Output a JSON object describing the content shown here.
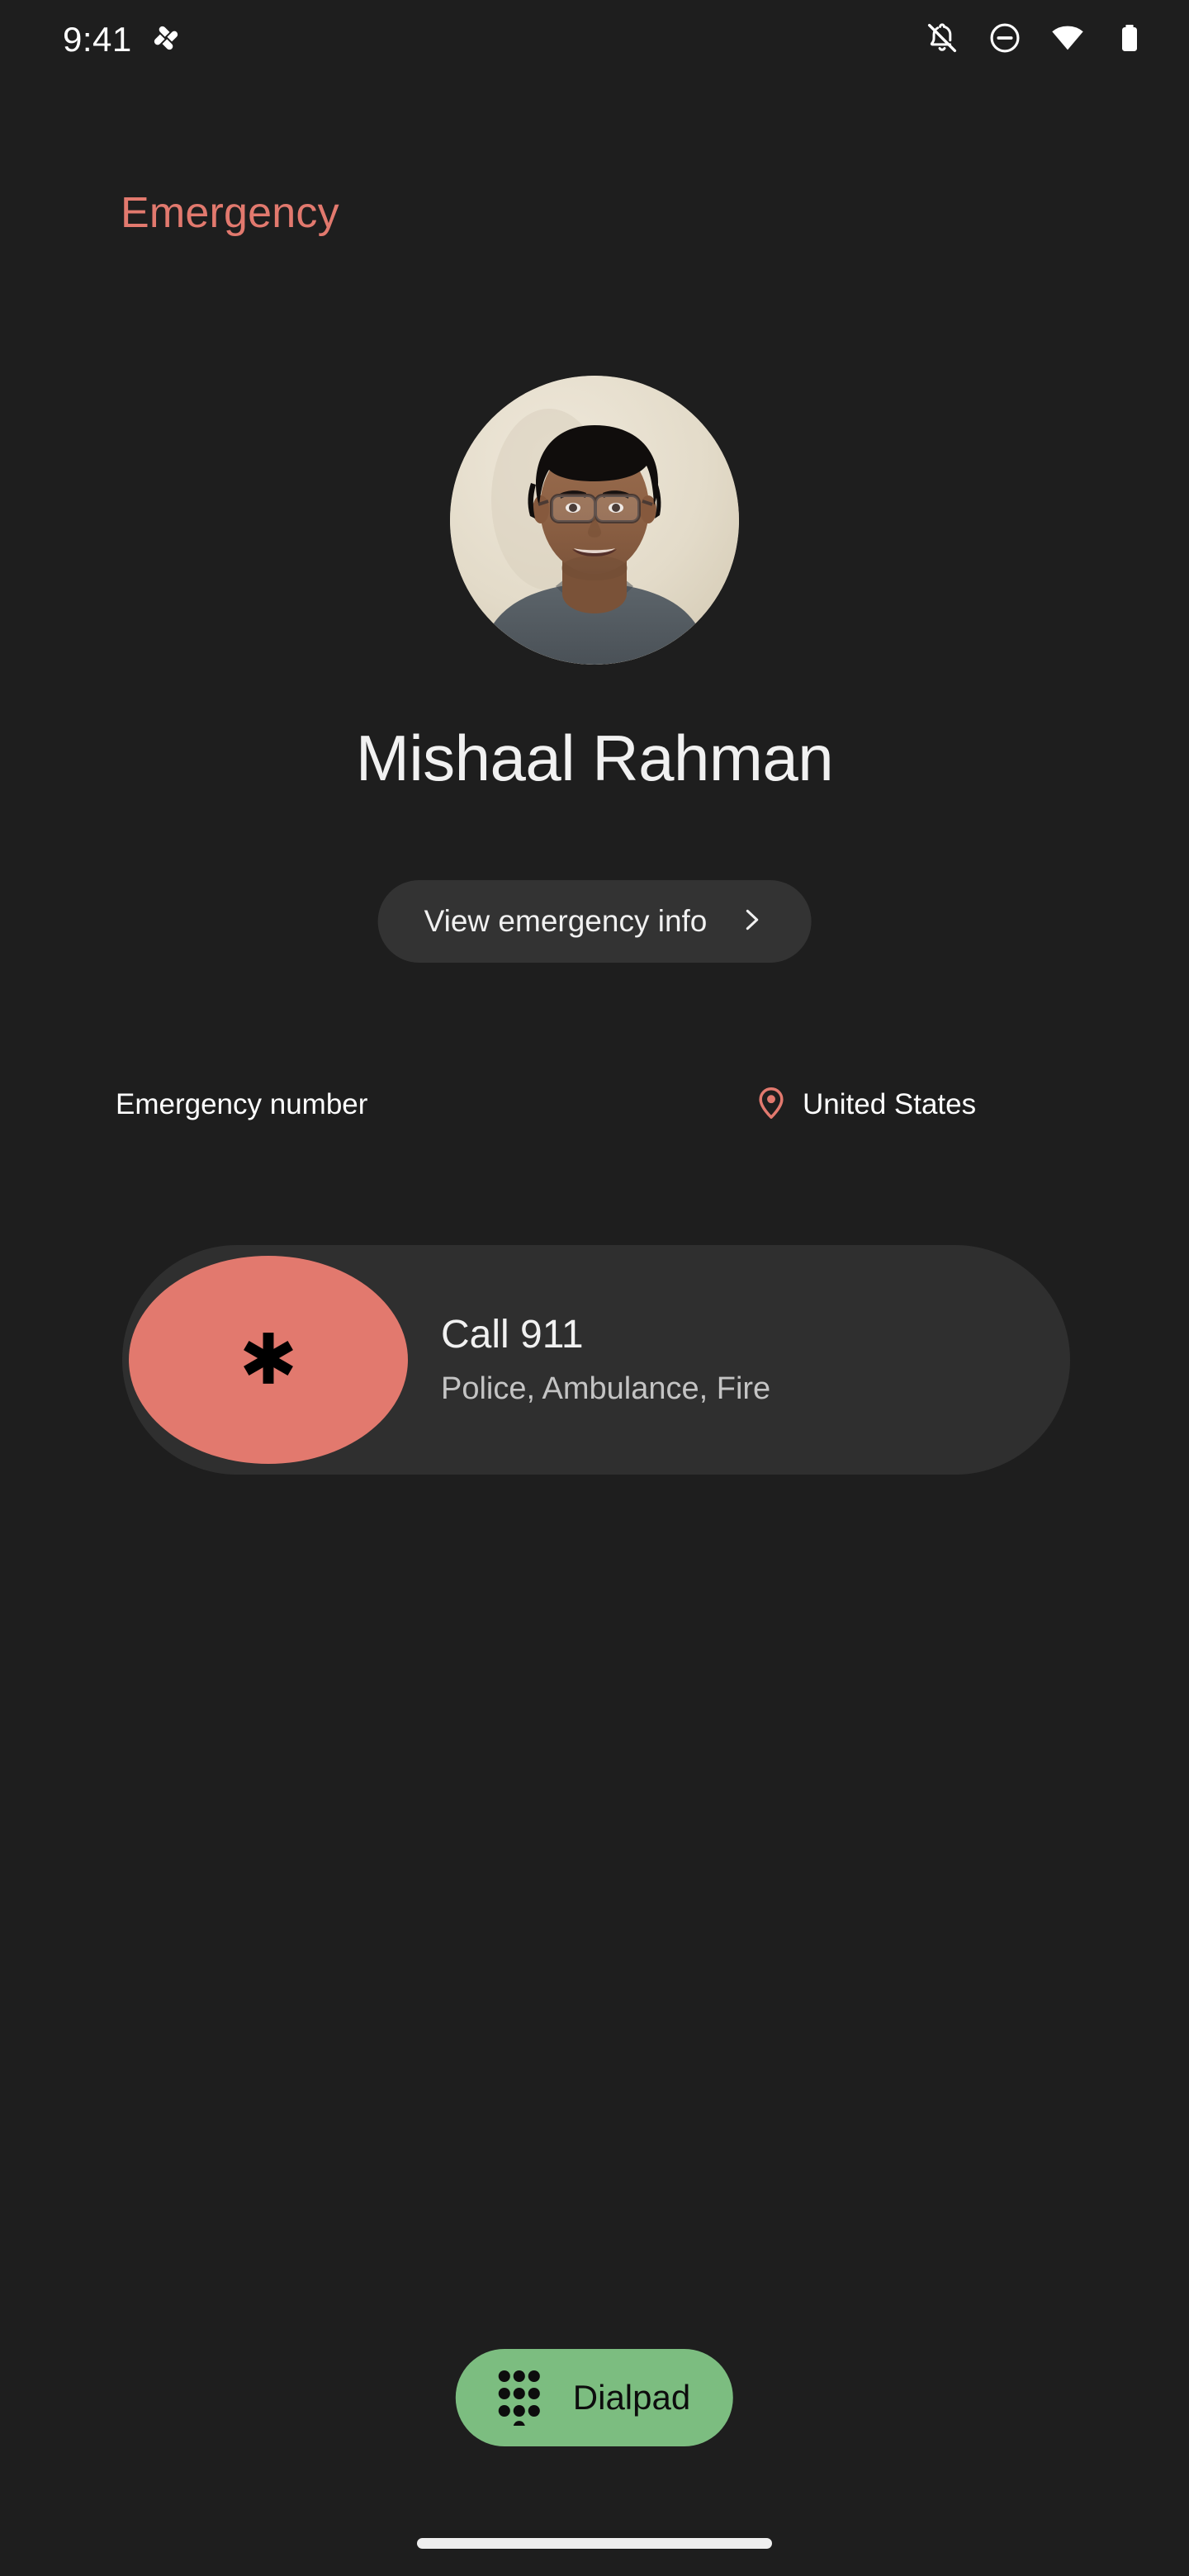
{
  "statusbar": {
    "time": "9:41",
    "left_icons": [
      {
        "name": "app-notification-icon",
        "label": "notification"
      }
    ],
    "right_icons": [
      {
        "name": "notifications-muted-icon",
        "label": "Notifications silenced"
      },
      {
        "name": "do-not-disturb-icon",
        "label": "Do not disturb"
      },
      {
        "name": "wifi-icon",
        "label": "Wi-Fi connected"
      },
      {
        "name": "battery-icon",
        "label": "Battery full"
      }
    ]
  },
  "header": {
    "title": "Emergency",
    "title_color": "#e2796e"
  },
  "contact": {
    "name": "Mishaal Rahman",
    "avatar_alt": "Profile photo of Mishaal Rahman"
  },
  "emergency_info_button": {
    "label": "View emergency info",
    "chevron": "chevron-right-icon"
  },
  "meta": {
    "number_label": "Emergency number",
    "country": "United States",
    "location_icon": "location-pin-icon"
  },
  "call_card": {
    "badge_icon": "asterisk-star-of-life-icon",
    "badge_color": "#e2796e",
    "title": "Call 911",
    "subtitle": "Police, Ambulance, Fire"
  },
  "dialpad_button": {
    "label": "Dialpad",
    "icon": "dialpad-dots-icon",
    "background_color": "#7cbd80"
  },
  "navigation": {
    "gesture_bar": "home-gesture-bar"
  },
  "theme": {
    "background": "#1e1e1e",
    "surface": "#2f2f2f",
    "accent_coral": "#e2796e",
    "accent_green": "#7cbd80",
    "text_primary": "#f1f1f1",
    "text_secondary": "#c4c4c4"
  }
}
